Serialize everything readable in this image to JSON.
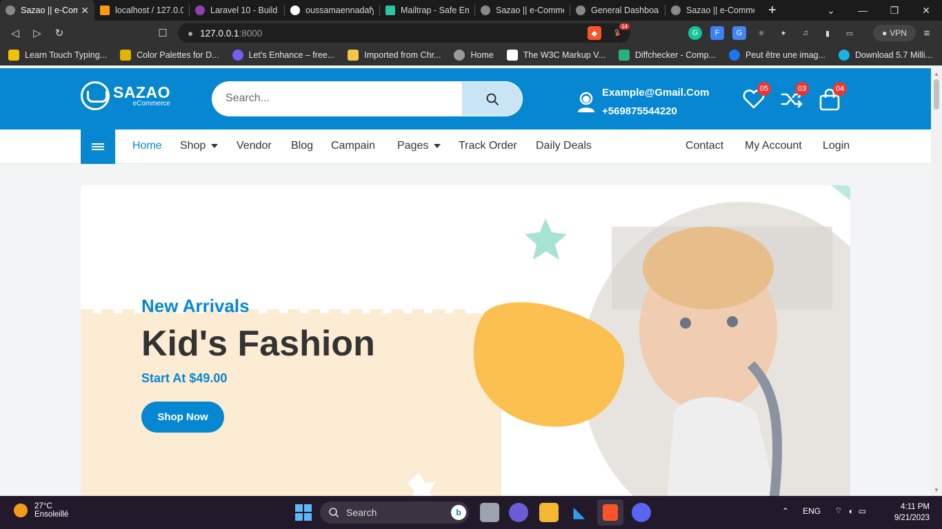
{
  "browser": {
    "tabs": [
      {
        "title": "Sazao || e-Com",
        "active": true,
        "color": "#888888"
      },
      {
        "title": "localhost / 127.0.0.",
        "active": false,
        "color": "#f89c0e"
      },
      {
        "title": "Laravel 10 - Build M",
        "active": false,
        "color": "#8e44ad"
      },
      {
        "title": "oussamaennadafy/",
        "active": false,
        "color": "#ffffff"
      },
      {
        "title": "Mailtrap - Safe Ema",
        "active": false,
        "color": "#2ec4a0"
      },
      {
        "title": "Sazao || e-Commer",
        "active": false,
        "color": "#888888"
      },
      {
        "title": "General Dashboard",
        "active": false,
        "color": "#888888"
      },
      {
        "title": "Sazao || e-Commer",
        "active": false,
        "color": "#888888"
      }
    ],
    "url_host": "127.0.0.1",
    "url_port": ":8000",
    "brave_count": "14",
    "vpn_label": "VPN",
    "bookmarks": [
      {
        "label": "Learn Touch Typing...",
        "color": "#f2c200"
      },
      {
        "label": "Color Palettes for D...",
        "color": "#e4b400"
      },
      {
        "label": "Let's Enhance – free...",
        "color": "#7b5cf5"
      },
      {
        "label": "Imported from Chr...",
        "color": "#f3c64a"
      },
      {
        "label": "Home",
        "color": "#9a9a9a"
      },
      {
        "label": "The W3C Markup V...",
        "color": "#ffffff"
      },
      {
        "label": "Diffchecker - Comp...",
        "color": "#25b37b"
      },
      {
        "label": "Peut être une imag...",
        "color": "#1877f2"
      },
      {
        "label": "Download 5.7 Milli...",
        "color": "#19b3e6"
      }
    ]
  },
  "site": {
    "brand": "SAZAO",
    "brand_sub": "eCommerce",
    "search_placeholder": "Search...",
    "email": "Example@Gmail.Com",
    "phone": "+569875544220",
    "wishlist_count": "05",
    "compare_count": "03",
    "cart_count": "04",
    "accent": "#0787d1",
    "nav": {
      "home": "Home",
      "shop": "Shop",
      "vendor": "Vendor",
      "blog": "Blog",
      "campain": "Campain",
      "pages": "Pages",
      "track_order": "Track Order",
      "daily_deals": "Daily Deals",
      "contact": "Contact",
      "my_account": "My Account",
      "login": "Login"
    },
    "hero": {
      "kicker": "New Arrivals",
      "headline": "Kid's Fashion",
      "price": "Start At $49.00",
      "cta": "Shop Now"
    }
  },
  "taskbar": {
    "temp": "27°C",
    "weather": "Ensoleillé",
    "search_label": "Search",
    "lang": "ENG",
    "time": "4:11 PM",
    "date": "9/21/2023"
  }
}
